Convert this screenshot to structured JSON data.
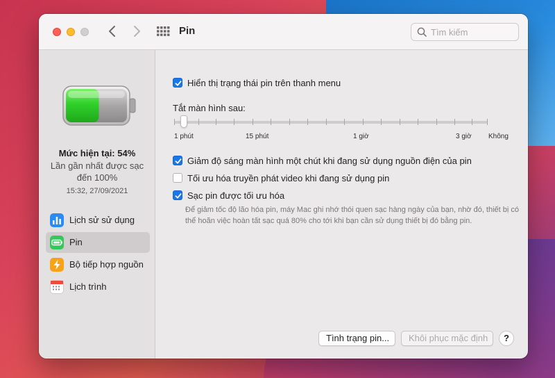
{
  "window": {
    "title": "Pin",
    "search_placeholder": "Tìm kiếm"
  },
  "sidebar": {
    "level_text": "Mức hiện tại: 54%",
    "last_charged": "Lần gần nhất được sạc đến 100%",
    "timestamp": "15:32, 27/09/2021",
    "battery_level": 0.54,
    "items": [
      {
        "label": "Lịch sử sử dụng",
        "icon": "usage-chart-icon",
        "selected": false
      },
      {
        "label": "Pin",
        "icon": "battery-icon",
        "selected": true
      },
      {
        "label": "Bộ tiếp hợp nguồn",
        "icon": "lightning-icon",
        "selected": false
      },
      {
        "label": "Lịch trình",
        "icon": "calendar-icon",
        "selected": false
      }
    ]
  },
  "settings": {
    "show_status": {
      "label": "Hiển thị trạng thái pin trên thanh menu",
      "checked": true
    },
    "slider": {
      "title": "Tắt màn hình sau:",
      "labels": [
        "1 phút",
        "15 phút",
        "1 giờ",
        "3 giờ",
        "Không"
      ],
      "value": "1 phút"
    },
    "dim_display": {
      "label": "Giảm độ sáng màn hình một chút khi đang sử dụng nguồn điện của pin",
      "checked": true
    },
    "optimize_video": {
      "label": "Tối ưu hóa truyền phát video khi đang sử dụng pin",
      "checked": false
    },
    "optimized_charging": {
      "label": "Sạc pin được tối ưu hóa",
      "checked": true,
      "description": "Để giảm tốc độ lão hóa pin, máy Mac ghi nhớ thói quen sạc hàng ngày của bạn, nhờ đó, thiết bị có thể hoãn việc hoàn tất sạc quá 80% cho tới khi bạn cần sử dụng thiết bị đó bằng pin."
    }
  },
  "buttons": {
    "battery_health": "Tình trạng pin...",
    "restore_defaults": "Khôi phục mặc định",
    "help": "?"
  },
  "colors": {
    "accent": "#1b76e8",
    "battery_green": "#2fd12a"
  }
}
